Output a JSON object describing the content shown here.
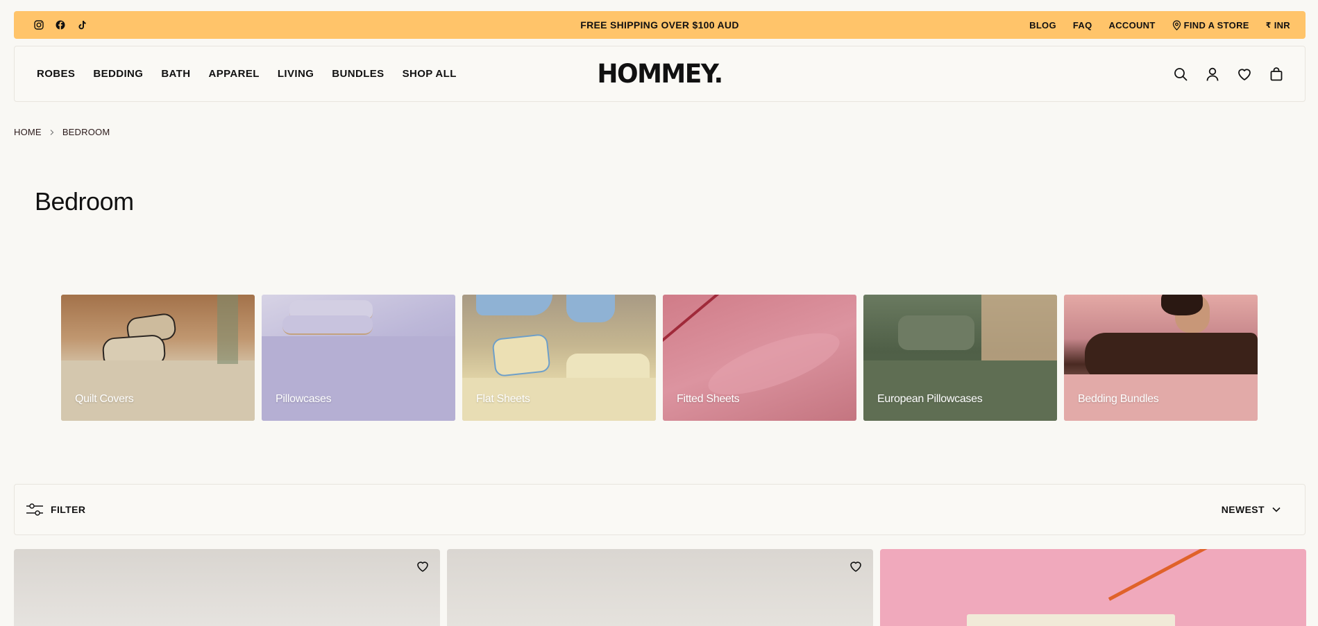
{
  "announcement": {
    "message": "FREE SHIPPING OVER $100 AUD",
    "social_icons": [
      "instagram-icon",
      "facebook-icon",
      "tiktok-icon"
    ],
    "links": {
      "blog": "BLOG",
      "faq": "FAQ",
      "account": "ACCOUNT",
      "find_store": "FIND A STORE",
      "currency_symbol": "₹",
      "currency": "INR"
    },
    "background": "#ffc46a"
  },
  "header": {
    "logo": "HOMMEY.",
    "nav": [
      "ROBES",
      "BEDDING",
      "BATH",
      "APPAREL",
      "LIVING",
      "BUNDLES",
      "SHOP ALL"
    ],
    "icons": [
      "search-icon",
      "account-icon",
      "heart-icon",
      "bag-icon"
    ]
  },
  "breadcrumb": {
    "home": "HOME",
    "current": "BEDROOM"
  },
  "page": {
    "title": "Bedroom"
  },
  "categories": [
    {
      "label": "Quilt Covers"
    },
    {
      "label": "Pillowcases"
    },
    {
      "label": "Flat Sheets"
    },
    {
      "label": "Fitted Sheets"
    },
    {
      "label": "European Pillowcases"
    },
    {
      "label": "Bedding Bundles"
    }
  ],
  "toolbar": {
    "filter_label": "FILTER",
    "sort_label": "NEWEST"
  },
  "products": {
    "wishlist_icon": "heart-icon"
  }
}
